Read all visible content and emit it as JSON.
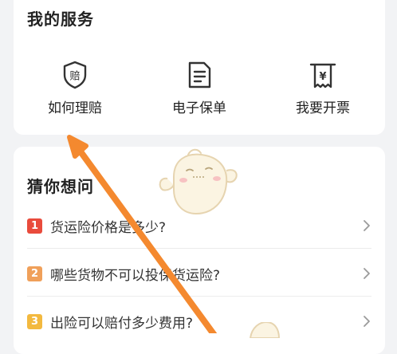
{
  "services": {
    "title": "我的服务",
    "items": [
      {
        "label": "如何理赔",
        "icon": "claim-shield-icon",
        "icon_glyph": "赔"
      },
      {
        "label": "电子保单",
        "icon": "document-icon"
      },
      {
        "label": "我要开票",
        "icon": "invoice-icon",
        "icon_glyph": "¥"
      }
    ]
  },
  "faq": {
    "title": "猜你想问",
    "items": [
      {
        "num": "1",
        "question": "货运险价格是多少?",
        "color": "#e94b3c"
      },
      {
        "num": "2",
        "question": "哪些货物不可以投保货运险?",
        "color": "#f0a05a"
      },
      {
        "num": "3",
        "question": "出险可以赔付多少费用?",
        "color": "#f3b93f"
      }
    ]
  },
  "colors": {
    "background": "#f2f3f5",
    "card": "#ffffff",
    "annotation_arrow": "#f4892f"
  }
}
